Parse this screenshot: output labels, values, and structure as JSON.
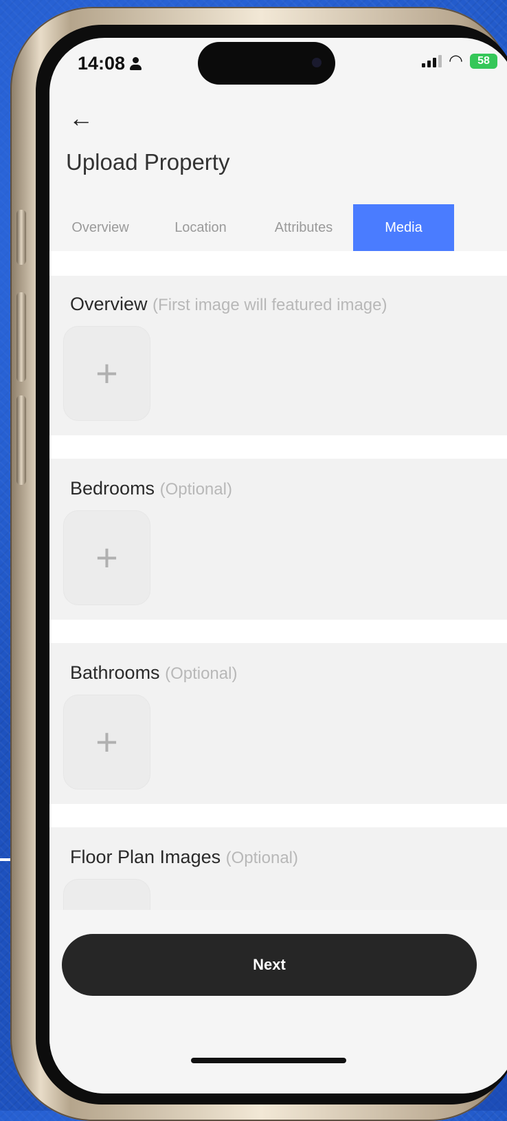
{
  "status_bar": {
    "time": "14:08",
    "battery": "58"
  },
  "header": {
    "title": "Upload Property"
  },
  "tabs": [
    {
      "label": "Overview"
    },
    {
      "label": "Location"
    },
    {
      "label": "Attributes"
    },
    {
      "label": "Media",
      "active": true
    }
  ],
  "sections": [
    {
      "title": "Overview",
      "note": "(First image will featured image)",
      "add_icon": "+"
    },
    {
      "title": "Bedrooms",
      "note": "(Optional)",
      "add_icon": "+"
    },
    {
      "title": "Bathrooms",
      "note": "(Optional)",
      "add_icon": "+"
    },
    {
      "title": "Floor Plan Images",
      "note": "(Optional)",
      "add_icon": "+"
    }
  ],
  "footer": {
    "next_label": "Next"
  },
  "icons": {
    "back": "arrow-left-icon",
    "add": "plus-icon",
    "wifi": "wifi-icon",
    "signal": "cellular-signal-icon",
    "battery": "battery-icon",
    "user": "person-icon"
  },
  "colors": {
    "accent": "#4a7cff",
    "button": "#262626",
    "battery": "#35c759"
  }
}
